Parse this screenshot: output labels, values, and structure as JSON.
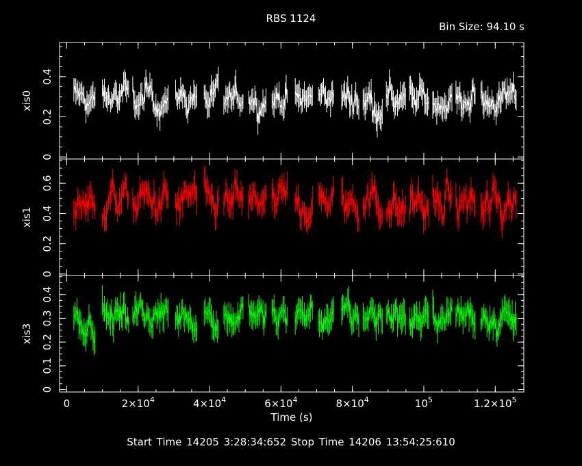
{
  "header": {
    "title": "RBS 1124",
    "bin_size": "Bin Size: 94.10 s"
  },
  "footer": {
    "times": "Start Time 14205  3:28:34:652     Stop Time 14206 13:54:25:610"
  },
  "chart_data": {
    "type": "line",
    "title": "RBS 1124",
    "xlabel": "Time (s)",
    "xlim": [
      -2000,
      128000
    ],
    "x_ticks": [
      {
        "value": 0,
        "label": "0",
        "exp": ""
      },
      {
        "value": 20000,
        "label": "2×10",
        "exp": "4"
      },
      {
        "value": 40000,
        "label": "4×10",
        "exp": "4"
      },
      {
        "value": 60000,
        "label": "6×10",
        "exp": "4"
      },
      {
        "value": 80000,
        "label": "8×10",
        "exp": "4"
      },
      {
        "value": 100000,
        "label": "10",
        "exp": "5"
      },
      {
        "value": 120000,
        "label": "1.2×10",
        "exp": "5"
      }
    ],
    "segments_s": [
      [
        2000,
        8000
      ],
      [
        10000,
        17500
      ],
      [
        18500,
        28500
      ],
      [
        30500,
        36500
      ],
      [
        38500,
        42500
      ],
      [
        44000,
        49500
      ],
      [
        51000,
        56000
      ],
      [
        57500,
        62000
      ],
      [
        64000,
        69000
      ],
      [
        70500,
        75000
      ],
      [
        77000,
        82000
      ],
      [
        83000,
        88500
      ],
      [
        89500,
        95000
      ],
      [
        96000,
        101500
      ],
      [
        102500,
        108000
      ],
      [
        109000,
        114500
      ],
      [
        116000,
        126000
      ]
    ],
    "panels": [
      {
        "name": "xis0",
        "color": "#ffffff",
        "ylim": [
          -0.01,
          0.57
        ],
        "yticks": [
          0,
          0.2,
          0.4
        ],
        "mean": 0.29,
        "spread": 0.035,
        "err": 0.05
      },
      {
        "name": "xis1",
        "color": "#ff0000",
        "ylim": [
          -0.01,
          0.76
        ],
        "yticks": [
          0,
          0.2,
          0.4,
          0.6
        ],
        "mean": 0.47,
        "spread": 0.06,
        "err": 0.07
      },
      {
        "name": "xis3",
        "color": "#00ff00",
        "ylim": [
          -0.01,
          0.48
        ],
        "yticks": [
          0,
          0.1,
          0.2,
          0.3,
          0.4
        ],
        "mean": 0.31,
        "spread": 0.03,
        "err": 0.045
      }
    ]
  }
}
